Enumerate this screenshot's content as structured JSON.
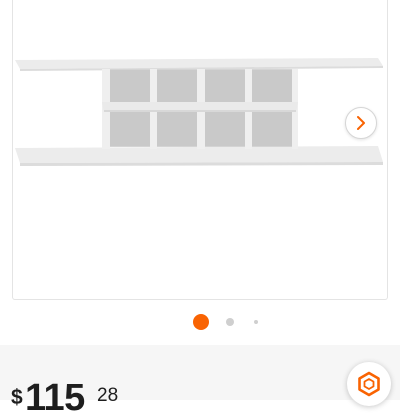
{
  "gallery": {
    "image_count": 3,
    "active_index": 0,
    "next_icon": "chevron-right-icon"
  },
  "price": {
    "currency": "$",
    "whole": "115",
    "cents": "28"
  },
  "floating_button": {
    "icon": "hexagon-logo-icon"
  },
  "colors": {
    "accent": "#f96302",
    "dot_inactive": "#cfcfcf",
    "price_text": "#1e1e1e",
    "band_background": "#f6f6f6"
  }
}
